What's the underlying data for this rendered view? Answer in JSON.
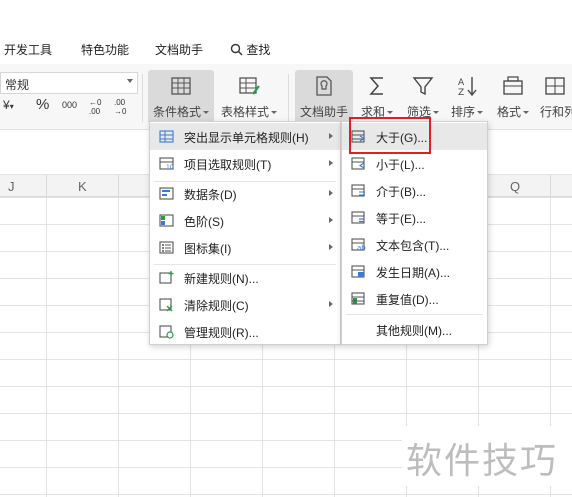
{
  "menubar": {
    "items": [
      "开发工具",
      "特色功能",
      "文档助手",
      "查找"
    ]
  },
  "ribbon": {
    "number_format": "常规",
    "numfmt_buttons": [
      "¥",
      "%",
      "000",
      "←0 .00",
      ".00 →0"
    ],
    "buttons": {
      "cond_format": "条件格式",
      "table_style": "表格样式",
      "doc_assistant": "文档助手",
      "sum": "求和",
      "filter": "筛选",
      "sort": "排序",
      "format": "格式",
      "row_col": "行和列"
    }
  },
  "columns": [
    "J",
    "K",
    "Q"
  ],
  "cond_menu": {
    "items": [
      {
        "label": "突出显示单元格规则(H)",
        "submenu": true
      },
      {
        "label": "项目选取规则(T)",
        "submenu": true
      },
      {
        "label": "数据条(D)",
        "submenu": true
      },
      {
        "label": "色阶(S)",
        "submenu": true
      },
      {
        "label": "图标集(I)",
        "submenu": true
      },
      {
        "label": "新建规则(N)...",
        "submenu": false
      },
      {
        "label": "清除规则(C)",
        "submenu": true
      },
      {
        "label": "管理规则(R)...",
        "submenu": false
      }
    ]
  },
  "highlight_submenu": {
    "items": [
      {
        "label": "大于(G)..."
      },
      {
        "label": "小于(L)..."
      },
      {
        "label": "介于(B)..."
      },
      {
        "label": "等于(E)..."
      },
      {
        "label": "文本包含(T)..."
      },
      {
        "label": "发生日期(A)..."
      },
      {
        "label": "重复值(D)..."
      },
      {
        "label": "其他规则(M)..."
      }
    ]
  },
  "watermark": "软件技巧",
  "colors": {
    "accent": "#3a7ad5",
    "highlight_box": "#e02020",
    "menu_hover": "#e8e8e8"
  }
}
